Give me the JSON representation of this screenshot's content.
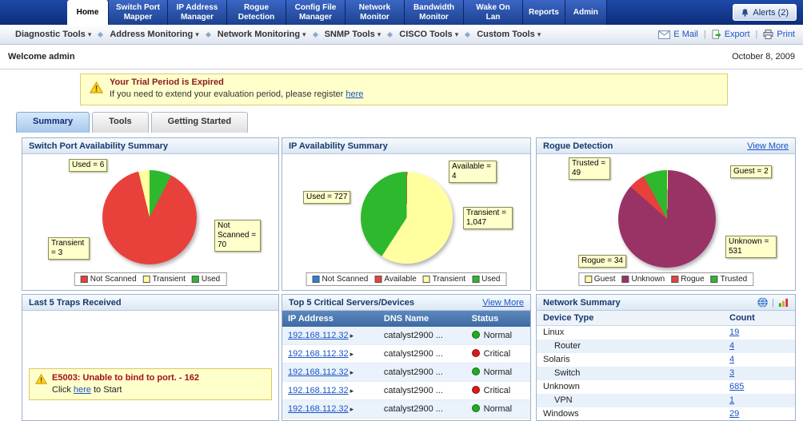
{
  "topnav": {
    "tabs": [
      {
        "label": "Home"
      },
      {
        "label": "Switch Port Mapper"
      },
      {
        "label": "IP Address Manager"
      },
      {
        "label": "Rogue Detection"
      },
      {
        "label": "Config File Manager"
      },
      {
        "label": "Network Monitor"
      },
      {
        "label": "Bandwidth Monitor"
      },
      {
        "label": "Wake On Lan"
      },
      {
        "label": "Reports"
      },
      {
        "label": "Admin"
      }
    ],
    "alerts": "Alerts (2)"
  },
  "menubar": {
    "items": [
      {
        "label": "Diagnostic Tools"
      },
      {
        "label": "Address Monitoring"
      },
      {
        "label": "Network Monitoring"
      },
      {
        "label": "SNMP Tools"
      },
      {
        "label": "CISCO Tools"
      },
      {
        "label": "Custom Tools"
      }
    ],
    "email": "E Mail",
    "export": "Export",
    "print": "Print"
  },
  "header": {
    "welcome": "Welcome  admin",
    "date": "October 8, 2009"
  },
  "trial": {
    "title": "Your Trial Period is Expired",
    "message": "If you need to extend your evaluation period, please register",
    "link": "here"
  },
  "tabs": [
    {
      "label": "Summary"
    },
    {
      "label": "Tools"
    },
    {
      "label": "Getting Started"
    }
  ],
  "panels": {
    "switch_port": {
      "title": "Switch Port Availability Summary",
      "chart_type": "pie",
      "callouts": [
        "Used = 6",
        "Transient = 3",
        "Not Scanned = 70"
      ],
      "slices": [
        {
          "name": "Used",
          "value": 6,
          "color": "#2eb82e"
        },
        {
          "name": "Not Scanned",
          "value": 70,
          "color": "#e8403a"
        },
        {
          "name": "Transient",
          "value": 3,
          "color": "#ffffa0"
        }
      ],
      "legend": [
        {
          "label": "Not Scanned",
          "color": "#e8403a"
        },
        {
          "label": "Transient",
          "color": "#ffffa0"
        },
        {
          "label": "Used",
          "color": "#2eb82e"
        }
      ]
    },
    "ip_availability": {
      "title": "IP Availability Summary",
      "chart_type": "pie",
      "callouts": [
        "Available = 4",
        "Used = 727",
        "Transient = 1,047"
      ],
      "slices": [
        {
          "name": "Available",
          "value": 4,
          "color": "#e8403a"
        },
        {
          "name": "Transient",
          "value": 1047,
          "color": "#ffffa0"
        },
        {
          "name": "Used",
          "value": 727,
          "color": "#2eb82e"
        }
      ],
      "legend": [
        {
          "label": "Not Scanned",
          "color": "#2b7fd4"
        },
        {
          "label": "Available",
          "color": "#e8403a"
        },
        {
          "label": "Transient",
          "color": "#ffffa0"
        },
        {
          "label": "Used",
          "color": "#2eb82e"
        }
      ]
    },
    "rogue": {
      "title": "Rogue Detection",
      "view_more": "View More",
      "chart_type": "pie",
      "callouts": [
        "Trusted = 49",
        "Guest = 2",
        "Rogue = 34",
        "Unknown = 531"
      ],
      "slices": [
        {
          "name": "Guest",
          "value": 2,
          "color": "#ffffa0"
        },
        {
          "name": "Unknown",
          "value": 531,
          "color": "#993366"
        },
        {
          "name": "Rogue",
          "value": 34,
          "color": "#e8403a"
        },
        {
          "name": "Trusted",
          "value": 49,
          "color": "#2eb82e"
        }
      ],
      "legend": [
        {
          "label": "Guest",
          "color": "#ffffa0"
        },
        {
          "label": "Unknown",
          "color": "#993366"
        },
        {
          "label": "Rogue",
          "color": "#e8403a"
        },
        {
          "label": "Trusted",
          "color": "#2eb82e"
        }
      ]
    },
    "traps": {
      "title": "Last 5 Traps Received",
      "error": "E5003: Unable to bind to port. - 162",
      "action_prefix": "Click",
      "action_link": "here",
      "action_suffix": "to Start"
    },
    "servers": {
      "title": "Top 5 Critical Servers/Devices",
      "view_more": "View More",
      "columns": [
        "IP Address",
        "DNS Name",
        "Status"
      ],
      "rows": [
        {
          "ip": "192.168.112.32",
          "dns": "catalyst2900 ...",
          "status": "Normal",
          "status_color": "#22aa22"
        },
        {
          "ip": "192.168.112.32",
          "dns": "catalyst2900 ...",
          "status": "Critical",
          "status_color": "#d81a1a"
        },
        {
          "ip": "192.168.112.32",
          "dns": "catalyst2900 ...",
          "status": "Normal",
          "status_color": "#22aa22"
        },
        {
          "ip": "192.168.112.32",
          "dns": "catalyst2900 ...",
          "status": "Critical",
          "status_color": "#d81a1a"
        },
        {
          "ip": "192.168.112.32",
          "dns": "catalyst2900 ...",
          "status": "Normal",
          "status_color": "#22aa22"
        }
      ]
    },
    "network": {
      "title": "Network Summary",
      "columns": [
        "Device Type",
        "Count"
      ],
      "rows": [
        {
          "type": "Linux",
          "count": "19"
        },
        {
          "type": "Router",
          "count": "4"
        },
        {
          "type": "Solaris",
          "count": "4"
        },
        {
          "type": "Switch",
          "count": "3"
        },
        {
          "type": "Unknown",
          "count": "685"
        },
        {
          "type": "VPN",
          "count": "1"
        },
        {
          "type": "Windows",
          "count": "29"
        }
      ]
    }
  }
}
